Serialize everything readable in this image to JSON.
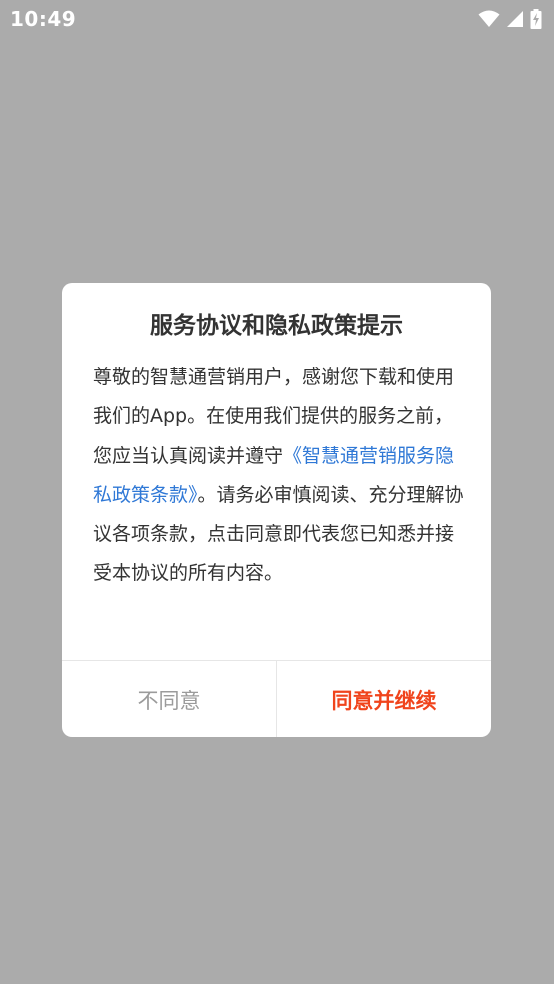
{
  "status_bar": {
    "time": "10:49",
    "icons": [
      "wifi-icon",
      "signal-icon",
      "battery-charging-icon"
    ]
  },
  "dialog": {
    "title": "服务协议和隐私政策提示",
    "body_prefix": "尊敬的智慧通营销用户，感谢您下载和使用我们的App。在使用我们提供的服务之前，您应当认真阅读并遵守",
    "policy_link": "《智慧通营销服务隐私政策条款》",
    "body_suffix": "。请务必审慎阅读、充分理解协议各项条款，点击同意即代表您已知悉并接受本协议的所有内容。",
    "disagree_label": "不同意",
    "agree_label": "同意并继续"
  },
  "colors": {
    "overlay": "#ababab",
    "link": "#2f78d6",
    "agree": "#f0441c",
    "disagree": "#9b9b9b"
  }
}
